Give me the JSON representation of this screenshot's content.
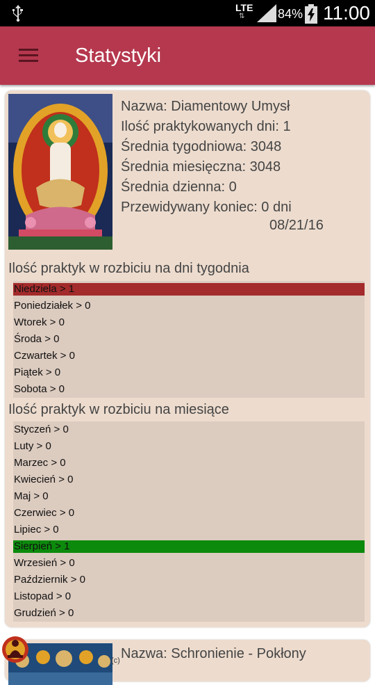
{
  "status_bar": {
    "network": "LTE",
    "battery": "84%",
    "time": "11:00",
    "icons": [
      "usb-icon",
      "signal-icon",
      "battery-charging-icon"
    ]
  },
  "app_bar": {
    "title": "Statystyki",
    "menu_icon": "hamburger-menu-icon"
  },
  "practice": {
    "name": "Nazwa: Diamentowy Umysł",
    "days": "Ilość praktykowanych dni: 1",
    "weekly_avg": "Średnia tygodniowa: 3048",
    "monthly_avg": "Średnia miesięczna: 3048",
    "daily_avg": "Średnia dzienna: 0",
    "predicted_end": "Przewidywany koniec: 0 dni",
    "end_date": "08/21/16"
  },
  "weekdays": {
    "title": "Ilość praktyk w rozbiciu na dni tygodnia",
    "items": [
      {
        "label": "Niedziela > 1",
        "highlight": "red"
      },
      {
        "label": "Poniedziałek > 0"
      },
      {
        "label": "Wtorek > 0"
      },
      {
        "label": "Środa > 0"
      },
      {
        "label": "Czwartek > 0"
      },
      {
        "label": "Piątek > 0"
      },
      {
        "label": "Sobota > 0"
      }
    ]
  },
  "months": {
    "title": "Ilość praktyk w rozbiciu na miesiące",
    "items": [
      {
        "label": "Styczeń > 0"
      },
      {
        "label": "Luty > 0"
      },
      {
        "label": "Marzec > 0"
      },
      {
        "label": "Kwiecień > 0"
      },
      {
        "label": "Maj > 0"
      },
      {
        "label": "Czerwiec > 0"
      },
      {
        "label": "Lipiec > 0"
      },
      {
        "label": "Sierpień > 1",
        "highlight": "green"
      },
      {
        "label": "Wrzesień > 0"
      },
      {
        "label": "Październik > 0"
      },
      {
        "label": "Listopad > 0"
      },
      {
        "label": "Grudzień > 0"
      }
    ]
  },
  "practice2": {
    "name": "Nazwa: Schronienie - Pokłony"
  },
  "copyright": "(c)",
  "colors": {
    "app_bar": "#b5384e",
    "card": "#eddcce",
    "list": "#dccbbf",
    "highlight_red": "#a32b2b",
    "highlight_green": "#0c8a0c"
  }
}
